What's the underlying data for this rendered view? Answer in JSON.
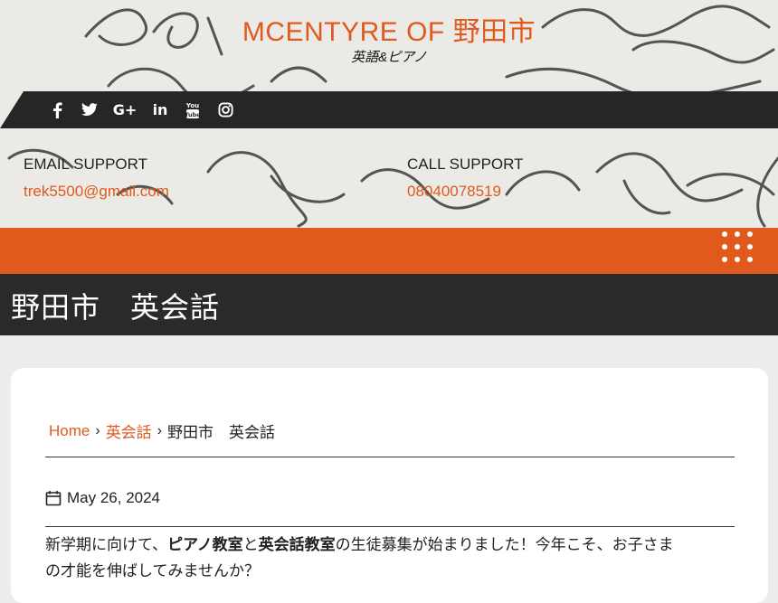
{
  "site": {
    "title": "MCENTYRE OF 野田市",
    "tagline": "英語&ピアノ"
  },
  "social": [
    {
      "name": "facebook-icon",
      "glyph": "f"
    },
    {
      "name": "twitter-icon",
      "glyph": "t"
    },
    {
      "name": "google-plus-icon",
      "glyph": "G+"
    },
    {
      "name": "linkedin-icon",
      "glyph": "in"
    },
    {
      "name": "youtube-icon",
      "glyph": "You Tube"
    },
    {
      "name": "instagram-icon",
      "glyph": "ig"
    }
  ],
  "support": {
    "email_label": "EMAIL SUPPORT",
    "email_value": "trek5500@gmail.com",
    "call_label": "CALL SUPPORT",
    "call_value": "08040078519"
  },
  "page": {
    "title": "野田市　英会話"
  },
  "breadcrumb": {
    "home": "Home",
    "category": "英会話",
    "current": "野田市　英会話"
  },
  "post": {
    "date": "May 26, 2024",
    "line1_a": "新学期に向けて、",
    "line1_b": "ピアノ教室",
    "line1_c": "と",
    "line1_d": "英会話教室",
    "line1_e": "の生徒募集が始まりました！今年こそ、お子さま",
    "line2": "の才能を伸ばしてみませんか？"
  },
  "colors": {
    "accent": "#e05a1d",
    "dark": "#262626"
  }
}
